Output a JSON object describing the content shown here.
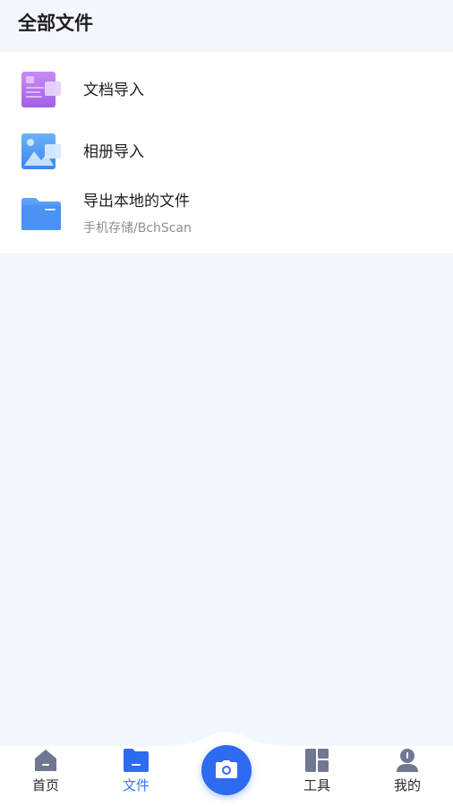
{
  "header": {
    "title": "全部文件"
  },
  "list": {
    "items": [
      {
        "label": "文档导入",
        "icon": "document-import-icon"
      },
      {
        "label": "相册导入",
        "icon": "album-import-icon"
      },
      {
        "label": "导出本地的文件",
        "sub": "手机存储/BchScan",
        "icon": "folder-icon"
      }
    ]
  },
  "tabbar": {
    "tabs": [
      {
        "label": "首页",
        "icon": "home-icon"
      },
      {
        "label": "文件",
        "icon": "folder-icon",
        "active": true
      },
      {
        "label": "工具",
        "icon": "tools-grid-icon"
      },
      {
        "label": "我的",
        "icon": "profile-icon"
      }
    ],
    "camera": {
      "icon": "camera-icon"
    }
  },
  "colors": {
    "page_bg": "#F3F7FE",
    "accent": "#2D7BF5",
    "camera_bg": "#2E6BF0",
    "doc_icon": "#B57AF0",
    "album_icon": "#4E9BF6",
    "folder_icon": "#3D8AF7",
    "tab_icon_inactive": "#6F7890"
  }
}
